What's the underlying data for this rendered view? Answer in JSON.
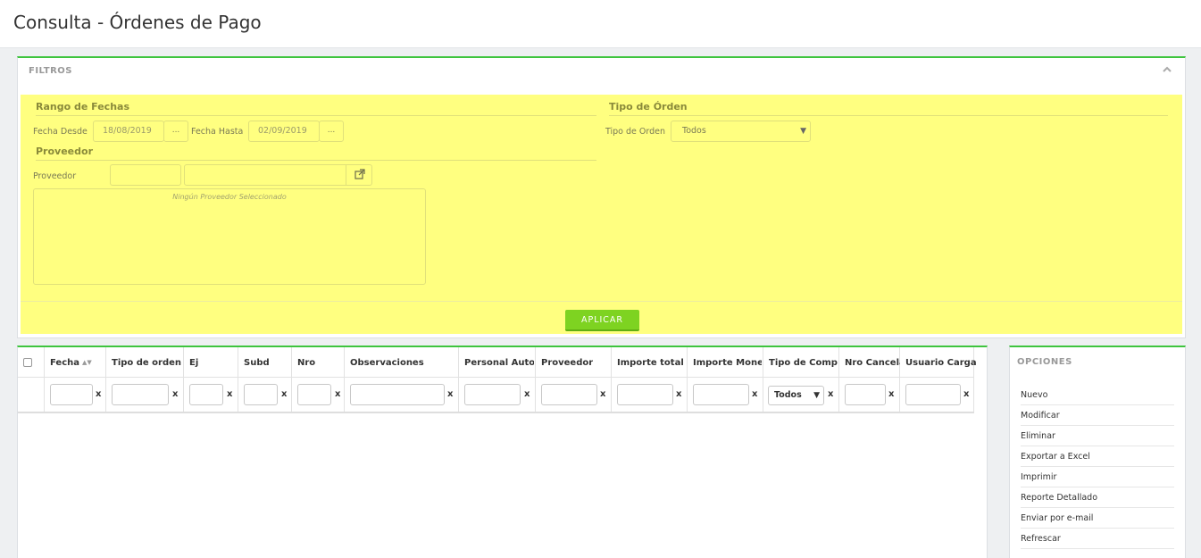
{
  "page": {
    "title": "Consulta - Órdenes de Pago"
  },
  "filters": {
    "title": "FILTROS",
    "rango": {
      "title": "Rango de Fechas",
      "desde_label": "Fecha Desde",
      "desde_value": "18/08/2019",
      "hasta_label": "Fecha Hasta",
      "hasta_value": "02/09/2019",
      "dots": "..."
    },
    "tipo": {
      "title": "Tipo de Órden",
      "label": "Tipo de Orden",
      "value": "Todos"
    },
    "proveedor": {
      "title": "Proveedor",
      "label": "Proveedor",
      "code_value": "",
      "name_value": "",
      "empty_text": "Ningún Proveedor Seleccionado"
    },
    "apply_label": "APLICAR"
  },
  "grid": {
    "columns": [
      {
        "label": "Fecha"
      },
      {
        "label": "Tipo de orden"
      },
      {
        "label": "Ej"
      },
      {
        "label": "Subd"
      },
      {
        "label": "Nro"
      },
      {
        "label": "Observaciones"
      },
      {
        "label": "Personal Autor"
      },
      {
        "label": "Proveedor"
      },
      {
        "label": "Importe total"
      },
      {
        "label": "Importe Monec"
      },
      {
        "label": "Tipo de Compr"
      },
      {
        "label": "Nro Cancela"
      },
      {
        "label": "Usuario Carga"
      }
    ],
    "clear_glyph": "x",
    "tipo_compr_filter": "Todos"
  },
  "options": {
    "title": "OPCIONES",
    "items": [
      "Nuevo",
      "Modificar",
      "Eliminar",
      "Exportar a Excel",
      "Imprimir",
      "Reporte Detallado",
      "Enviar por e-mail",
      "Refrescar"
    ]
  },
  "colors": {
    "accent_green": "#3ec43e",
    "filter_bg": "#ffff80",
    "apply_button": "#7ed321"
  }
}
